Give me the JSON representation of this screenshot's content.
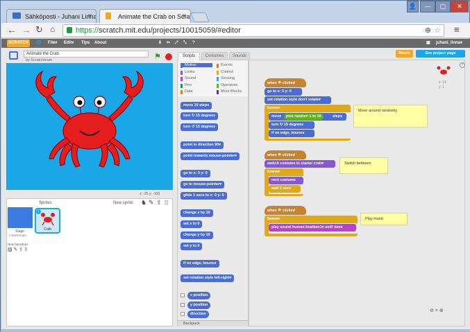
{
  "browser": {
    "tabs": [
      {
        "label": "Sähköposti - Juhani Linna"
      },
      {
        "label": "Animate the Crab on Scratch"
      }
    ],
    "url_scheme": "https://",
    "url_rest": "scratch.mit.edu/projects/10015059/#editor"
  },
  "scratch_menu": {
    "logo": "SCRATCH",
    "file": "File▾",
    "edit": "Edit▾",
    "tips": "Tips",
    "about": "About",
    "user": "juhani_linna▾"
  },
  "project": {
    "title": "Animate the Crab",
    "author": "by Scratchteam",
    "coords": "x: -25   y: -100"
  },
  "sprites_panel": {
    "header": "Sprites",
    "new_sprite": "New sprite:",
    "stage_label": "Stage",
    "stage_sub": "2 backdrops",
    "new_backdrop": "New backdrop:",
    "sprite_name": "Crab"
  },
  "editor_tabs": [
    "Scripts",
    "Costumes",
    "Sounds"
  ],
  "categories": [
    {
      "label": "Motion",
      "color": "#4a6cd4"
    },
    {
      "label": "Events",
      "color": "#c88330"
    },
    {
      "label": "Looks",
      "color": "#8a55d7"
    },
    {
      "label": "Control",
      "color": "#e1a91a"
    },
    {
      "label": "Sound",
      "color": "#bb42c3"
    },
    {
      "label": "Sensing",
      "color": "#2ca5e2"
    },
    {
      "label": "Pen",
      "color": "#0e9a6c"
    },
    {
      "label": "Operators",
      "color": "#5cb712"
    },
    {
      "label": "Data",
      "color": "#ee7d16"
    },
    {
      "label": "More Blocks",
      "color": "#632d99"
    }
  ],
  "palette_blocks": [
    "move 10 steps",
    "turn ↻ 15 degrees",
    "turn ↺ 15 degrees",
    "point in direction 90▾",
    "point towards mouse-pointer▾",
    "go to x: 0 y: 0",
    "go to mouse-pointer▾",
    "glide 1 secs to x: 0 y: 0",
    "change x by 10",
    "set x to 0",
    "change y by 10",
    "set y to 0",
    "if on edge, bounce",
    "set rotation style left-right▾",
    "x position",
    "y position",
    "direction"
  ],
  "backpack": "Backpack",
  "buttons": {
    "remix": "Remix",
    "see_project_page": "See project page"
  },
  "sprite_info": {
    "x": "x: 14",
    "y": "y: 1"
  },
  "scripts": {
    "s1": {
      "hat": "when ⚑ clicked",
      "goto": "go to x: 0 y: 0",
      "rotation": "set rotation style don't rotate▾",
      "forever": "forever",
      "move": "move",
      "pick": "pick random 1 to 10",
      "steps": "steps",
      "turn": "turn ↻ 15 degrees",
      "bounce": "if on edge, bounce",
      "comment": "Move around randomly"
    },
    "s2": {
      "hat": "when ⚑ clicked",
      "switch": "switch costume to starter crab▾",
      "forever": "forever",
      "next": "next costume",
      "wait": "wait 1 secs",
      "comment": "Switch between"
    },
    "s3": {
      "hat": "when ⚑ clicked",
      "forever": "forever",
      "play": "play sound human beatbox1▾ until done",
      "comment": "Play music"
    }
  },
  "zoom": "⊖ = ⊕"
}
